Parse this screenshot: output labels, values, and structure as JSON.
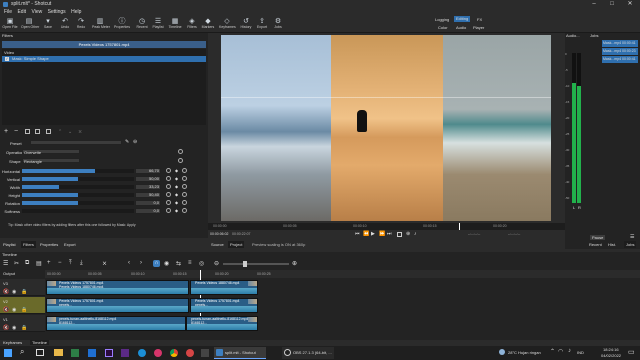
{
  "window": {
    "title": "split.mlt* - Shotcut",
    "controls": [
      "–",
      "□",
      "✕"
    ]
  },
  "menu": [
    "File",
    "Edit",
    "View",
    "Settings",
    "Help"
  ],
  "toolbar": [
    {
      "label": "Open File",
      "icon": "folder-icon",
      "glyph": "▣"
    },
    {
      "label": "Open Other",
      "icon": "open-other-icon",
      "glyph": "▤"
    },
    {
      "label": "Save",
      "icon": "save-icon",
      "glyph": "▾"
    },
    {
      "label": "Undo",
      "icon": "undo-icon",
      "glyph": "↶"
    },
    {
      "label": "Redo",
      "icon": "redo-icon",
      "glyph": "↷"
    },
    {
      "label": "Peak Meter",
      "icon": "peak-meter-icon",
      "glyph": "▥"
    },
    {
      "label": "Properties",
      "icon": "properties-icon",
      "glyph": "ⓘ"
    },
    {
      "label": "Recent",
      "icon": "recent-icon",
      "glyph": "◷"
    },
    {
      "label": "Playlist",
      "icon": "playlist-icon",
      "glyph": "☰"
    },
    {
      "label": "Timeline",
      "icon": "timeline-icon",
      "glyph": "▦"
    },
    {
      "label": "Filters",
      "icon": "filters-icon",
      "glyph": "◈"
    },
    {
      "label": "Markers",
      "icon": "markers-icon",
      "glyph": "◆"
    },
    {
      "label": "Keyframes",
      "icon": "keyframes-icon",
      "glyph": "◇"
    },
    {
      "label": "History",
      "icon": "history-icon",
      "glyph": "↺"
    },
    {
      "label": "Export",
      "icon": "export-icon",
      "glyph": "⇪"
    },
    {
      "label": "Jobs",
      "icon": "jobs-icon",
      "glyph": "⚙"
    }
  ],
  "layout_switcher": {
    "top": [
      "Logging",
      "Editing",
      "FX"
    ],
    "bottom": [
      "Color",
      "Audio",
      "Player"
    ],
    "active": "Editing"
  },
  "filters_panel": {
    "title": "Filters",
    "clip_title": "Pexels Videos 1757801.mp4",
    "groups": [
      {
        "label": "Video",
        "items": [
          {
            "label": "Mask: Simple Shape",
            "checked": true
          }
        ]
      }
    ],
    "preset_label": "Preset",
    "operation": {
      "label": "Operation",
      "value": "Overwrite"
    },
    "shape": {
      "label": "Shape",
      "value": "Rectangle"
    },
    "params": [
      {
        "label": "Horizontal",
        "value": "66,70",
        "level": 0.65
      },
      {
        "label": "Vertical",
        "value": "50,00",
        "level": 0.5
      },
      {
        "label": "Width",
        "value": "33,23",
        "level": 0.33
      },
      {
        "label": "Height",
        "value": "50,40",
        "level": 0.5
      },
      {
        "label": "Rotation",
        "value": "0,0",
        "level": 0.5
      },
      {
        "label": "Softness",
        "value": "0,0",
        "level": 0
      }
    ],
    "tip": "Tip: Mask other video filters by adding filters after this one followed by Mask: Apply",
    "tabs": [
      "Playlist",
      "Filters",
      "Properties",
      "Export"
    ]
  },
  "player": {
    "scrub_ticks": [
      "00:00:00",
      "00:00:05",
      "00:00:10",
      "00:00:15",
      "00:00:20"
    ],
    "timecode": "00:00:06:02",
    "duration": "00:00:22:07",
    "in_point": "--:--:--:--",
    "out_point": "--:--:--:--",
    "tabs": [
      "Source",
      "Project"
    ],
    "scale_note": "Preview scaling is ON at 360p"
  },
  "audio_meter": {
    "title": "Audio...",
    "scale": [
      "0",
      "-5",
      "-10",
      "-15",
      "-20",
      "-25",
      "-30",
      "-35",
      "-40",
      "-50"
    ],
    "channels": [
      "L",
      "R"
    ],
    "level_L": 0.8,
    "level_R": 0.78
  },
  "jobs": {
    "title": "Jobs",
    "items": [
      {
        "name": "Mask...mp4",
        "time": "00:00:41"
      },
      {
        "name": "Mask...mp4",
        "time": "00:00:23"
      },
      {
        "name": "Mask...mp4",
        "time": "00:00:41"
      }
    ],
    "pause_label": "Pause",
    "tabs": [
      "Recent",
      "Hist.",
      "Jobs"
    ]
  },
  "timeline": {
    "title": "Timeline",
    "ruler": [
      "00:00:00",
      "00:00:05",
      "00:00:10",
      "00:00:15",
      "00:00:20",
      "00:00:25"
    ],
    "output_label": "Output",
    "tracks": [
      {
        "name": "V3",
        "clips": [
          {
            "title": "Pexels Videos 1757801.mp4",
            "subtitle": "Pexels Videos 1880746.mp4"
          },
          {
            "title": "Pexels Videos 1880746.mp4",
            "subtitle": ""
          }
        ]
      },
      {
        "name": "V2",
        "clips": [
          {
            "title": "Pexels Videos 1757801.mp4",
            "subtitle": "pexels..."
          },
          {
            "title": "Pexels Videos 1757801.mp4",
            "subtitle": "pexels..."
          }
        ]
      },
      {
        "name": "V1",
        "clips": [
          {
            "title": "pexels-tunan-aaltinellu-8168112.mp4",
            "subtitle": "8168112..."
          },
          {
            "title": "pexels-tunan-aaltinellu-8168112.mp4",
            "subtitle": "8168112..."
          }
        ]
      }
    ],
    "tabs": [
      "Keyframes",
      "Timeline"
    ]
  },
  "taskbar": {
    "active_window": "split.mlt - Shotcut",
    "secondary": "OBS 27.1.3 (64-bit, ...",
    "weather": "28°C Hujan ringan",
    "lang": "IND",
    "time": "18:24:16",
    "date": "04/02/2022"
  },
  "colors": {
    "accent": "#3d7fc0",
    "selection": "#2f6fae",
    "meter": "#22b14c",
    "active_track": "#6a6a2a"
  }
}
